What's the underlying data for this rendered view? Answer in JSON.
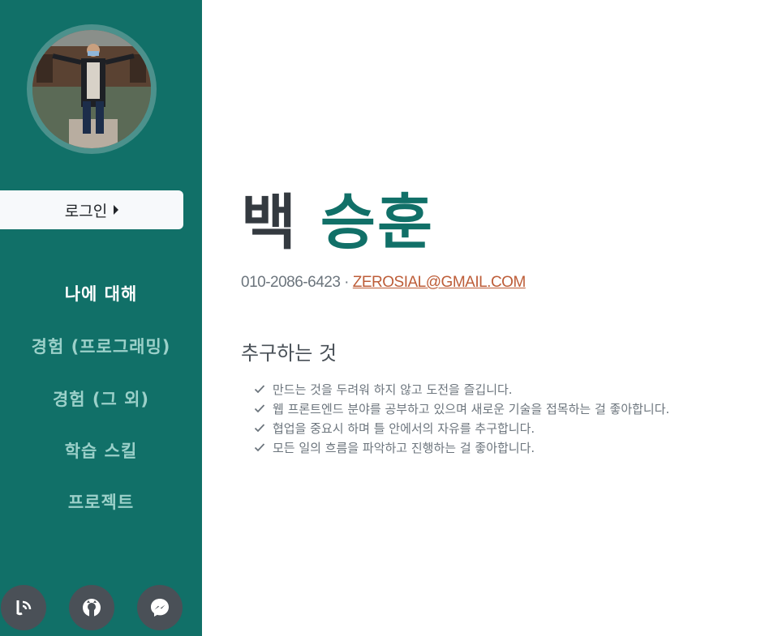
{
  "sidebar": {
    "login_label": "로그인",
    "nav": [
      {
        "label": "나에 대해",
        "active": true
      },
      {
        "label": "경험 (프로그래밍)",
        "active": false
      },
      {
        "label": "경험 (그 외)",
        "active": false
      },
      {
        "label": "학습 스킬",
        "active": false
      },
      {
        "label": "프로젝트",
        "active": false
      }
    ],
    "social": [
      "blog-icon",
      "github-icon",
      "messenger-icon"
    ]
  },
  "profile": {
    "first_name": "백",
    "last_name": "승훈",
    "phone": "010-2086-6423",
    "separator": "·",
    "email": "ZEROSIAL@GMAIL.COM"
  },
  "about": {
    "title": "추구하는 것",
    "items": [
      "만드는 것을 두려워 하지 않고 도전을 즐깁니다.",
      "웹 프론트엔드 분야를 공부하고 있으며 새로운 기술을 접목하는 걸 좋아합니다.",
      "협업을 중요시 하며 틀 안에서의 자유를 추구합니다.",
      "모든 일의 흐름을 파악하고 진행하는 걸 좋아합니다."
    ]
  },
  "colors": {
    "sidebar": "#117068",
    "accent_text": "#117068",
    "link": "#bd5d38",
    "nav_inactive": "#9bd0c9"
  }
}
